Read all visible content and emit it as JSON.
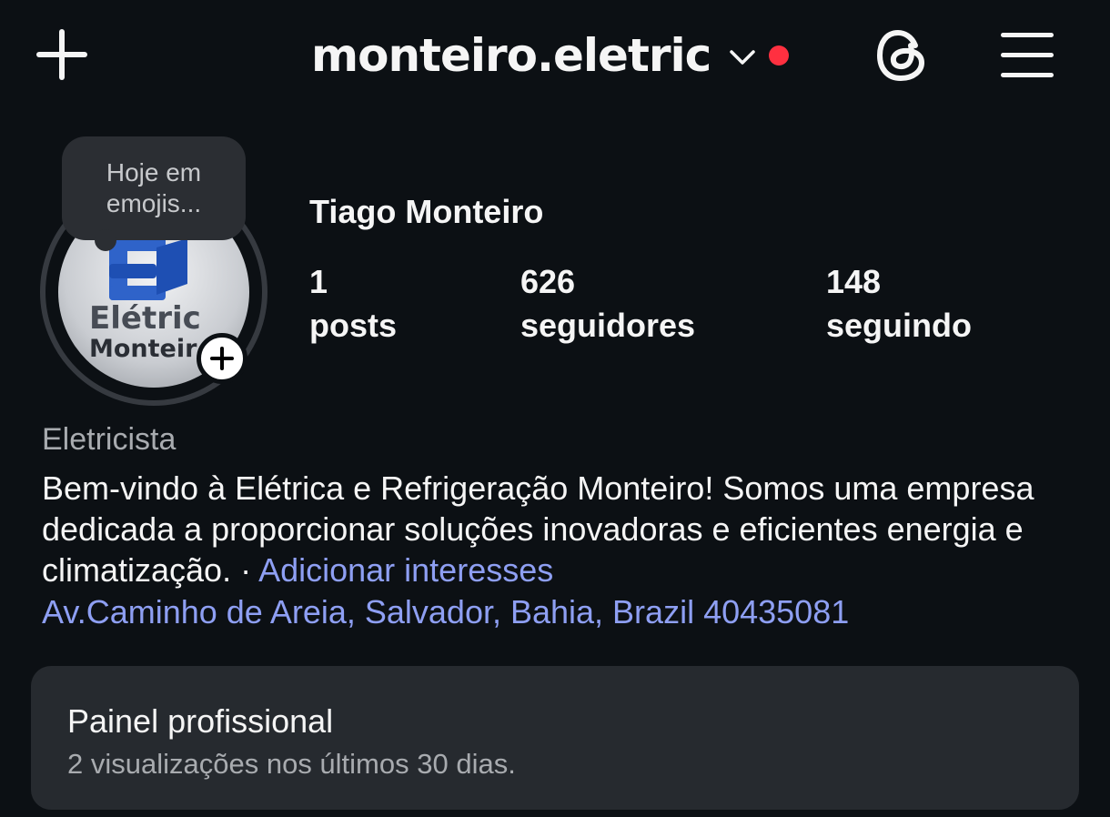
{
  "header": {
    "username": "monteiro.eletric",
    "notification_dot_color": "#ff3040",
    "icons": [
      "plus-icon",
      "chevron-down-icon",
      "threads-icon",
      "menu-icon"
    ]
  },
  "profile": {
    "note": "Hoje em emojis...",
    "avatar_text_line1": "Elétric",
    "avatar_text_line2": "Monteir",
    "display_name": "Tiago Monteiro",
    "stats": {
      "posts_count": "1",
      "posts_label": "posts",
      "followers_count": "626",
      "followers_label": "seguidores",
      "following_count": "148",
      "following_label": "seguindo"
    },
    "category": "Eletricista",
    "bio": "Bem-vindo à Elétrica e Refrigeração Monteiro! Somos uma empresa dedicada a proporcionar soluções inovadoras e eficientes energia e climatização. · ",
    "bio_link": "Adicionar interesses",
    "address": "Av.Caminho de Areia, Salvador, Bahia, Brazil 40435081",
    "link_color": "#8e9ff3"
  },
  "dashboard": {
    "title": "Painel profissional",
    "subtitle": "2 visualizações nos últimos 30 dias."
  }
}
